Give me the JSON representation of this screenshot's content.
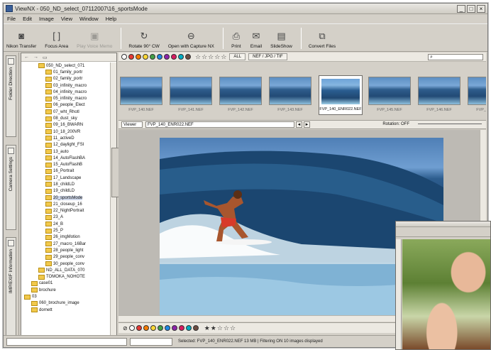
{
  "window": {
    "title": "ViewNX - 050_ND_select_07112007\\16_sportsMode",
    "controls": [
      "_",
      "□",
      "×"
    ]
  },
  "menu": [
    "File",
    "Edit",
    "Image",
    "View",
    "Window",
    "Help"
  ],
  "toolbar": {
    "items": [
      {
        "label": "Nikon Transfer",
        "icon": "camera-icon",
        "enabled": true
      },
      {
        "label": "Focus Area",
        "icon": "focus-area-icon",
        "enabled": true
      },
      {
        "label": "Play Voice Memo",
        "icon": "voice-memo-icon",
        "enabled": false
      },
      {
        "label": "Rotate 90° CW",
        "icon": "rotate-icon",
        "enabled": true
      },
      {
        "label": "Open with Capture NX",
        "icon": "capture-nx-icon",
        "enabled": true
      },
      {
        "label": "Print",
        "icon": "print-icon",
        "enabled": true
      },
      {
        "label": "Email",
        "icon": "email-icon",
        "enabled": true
      },
      {
        "label": "SlideShow",
        "icon": "slideshow-icon",
        "enabled": true
      },
      {
        "label": "Convert Files",
        "icon": "convert-icon",
        "enabled": true
      }
    ]
  },
  "sidebar_tabs": [
    "Folder Direction",
    "Camera Settings",
    "IMP/EXIF Information"
  ],
  "tree": {
    "items": [
      {
        "label": "050_ND_select_071",
        "indent": 2
      },
      {
        "label": "01_family_portr",
        "indent": 3
      },
      {
        "label": "02_family_portr",
        "indent": 3
      },
      {
        "label": "03_infinity_macro",
        "indent": 3
      },
      {
        "label": "04_infinity_macro",
        "indent": 3
      },
      {
        "label": "05_infinity_macro",
        "indent": 3
      },
      {
        "label": "06_people_Elect",
        "indent": 3
      },
      {
        "label": "07_wht_Rhotl",
        "indent": 3
      },
      {
        "label": "08_dust_sky",
        "indent": 3
      },
      {
        "label": "09_16_BWARN",
        "indent": 3
      },
      {
        "label": "10_18_200VR",
        "indent": 3
      },
      {
        "label": "11_activeD",
        "indent": 3
      },
      {
        "label": "12_daylight_FSI",
        "indent": 3
      },
      {
        "label": "13_auto",
        "indent": 3
      },
      {
        "label": "14_AutoFlashBA",
        "indent": 3
      },
      {
        "label": "15_AutoFlashB",
        "indent": 3
      },
      {
        "label": "16_Portrait",
        "indent": 3
      },
      {
        "label": "17_Landscape",
        "indent": 3
      },
      {
        "label": "18_childLD",
        "indent": 3
      },
      {
        "label": "19_childLD",
        "indent": 3
      },
      {
        "label": "20_sportsMode",
        "indent": 3,
        "selected": true
      },
      {
        "label": "21_closeup_16",
        "indent": 3
      },
      {
        "label": "22_NightPortrait",
        "indent": 3
      },
      {
        "label": "23_A",
        "indent": 3
      },
      {
        "label": "24_B",
        "indent": 3
      },
      {
        "label": "25_P",
        "indent": 3
      },
      {
        "label": "26_imgMotion",
        "indent": 3
      },
      {
        "label": "27_macro_16Bar",
        "indent": 3
      },
      {
        "label": "28_people_light",
        "indent": 3
      },
      {
        "label": "29_people_conv",
        "indent": 3
      },
      {
        "label": "30_people_conv",
        "indent": 3
      },
      {
        "label": "ND_ALL_DATA_070",
        "indent": 2
      },
      {
        "label": "TOMOKA_NOHOTE",
        "indent": 2
      },
      {
        "label": "case01",
        "indent": 1
      },
      {
        "label": "brochure",
        "indent": 1
      },
      {
        "label": "03",
        "indent": 0
      },
      {
        "label": "060_brochure_image",
        "indent": 1
      },
      {
        "label": "dornett",
        "indent": 1
      }
    ]
  },
  "filter": {
    "label_colors": [
      "#ffffff",
      "#e53935",
      "#f57c00",
      "#fdd835",
      "#43a047",
      "#1e88e5",
      "#8e24aa",
      "#d81b60",
      "#00acc1",
      "#6d4c41"
    ],
    "stars": 5,
    "tabs": [
      "ALL",
      "NEF / JPG / TIF"
    ]
  },
  "thumbnails": {
    "items": [
      "FVP_140.NEF",
      "FVP_141.NEF",
      "FVP_142.NEF",
      "FVP_143.NEF",
      "FVP_144.NEF",
      "FVP_145.NEF",
      "FVP_146.NEF",
      "FVP_147.NEF"
    ],
    "active_index": 3,
    "active_caption": "FVP_140_ENR022.NEF"
  },
  "viewer": {
    "mode_label": "Viewer",
    "filename": "FVP_140_ENR022.NEF",
    "rotation": "Rotation: OFF",
    "nav": [
      "◄",
      "►"
    ]
  },
  "rating": {
    "stars_filled": 2,
    "stars_total": 5
  },
  "status": {
    "text": "Selected: FVP_140_ENR022.NEF  13 MB  |  Filtering ON  10 images displayed"
  }
}
